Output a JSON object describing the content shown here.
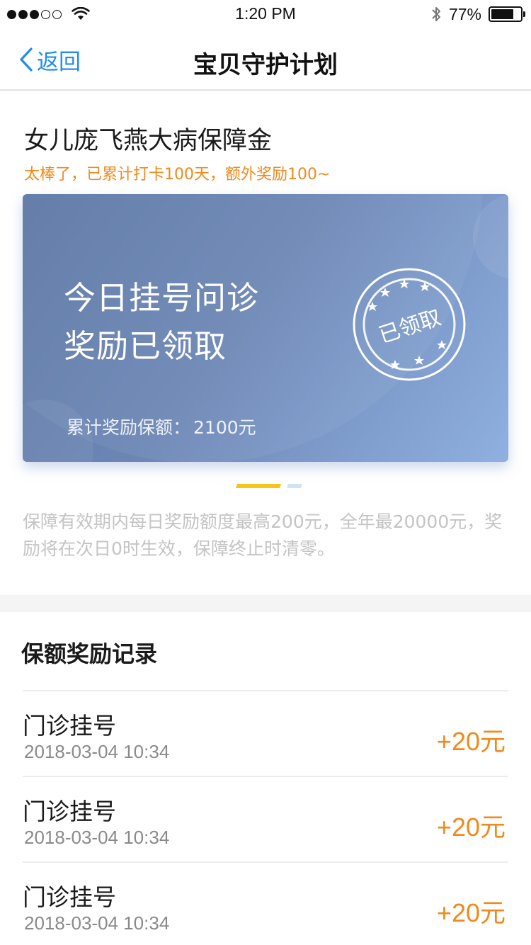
{
  "status_bar": {
    "time": "1:20 PM",
    "battery_percent": "77%",
    "battery_level": 0.77,
    "signal_dots_filled": 3,
    "signal_dots_total": 5
  },
  "nav": {
    "back_label": "返回",
    "title": "宝贝守护计划"
  },
  "plan": {
    "title": "女儿庞飞燕大病保障金",
    "subtitle": "太棒了，已累计打卡100天，额外奖励100~",
    "card": {
      "line1": "今日挂号问诊",
      "line2": "奖励已领取",
      "total_label": "累计奖励保额：",
      "total_value": "2100元",
      "stamp_text": "已领取"
    },
    "note": "保障有效期内每日奖励额度最高200元，全年最20000元，奖励将在次日0时生效，保障终止时清零。"
  },
  "records": {
    "title": "保额奖励记录",
    "items": [
      {
        "name": "门诊挂号",
        "time": "2018-03-04 10:34",
        "amount": "+20元"
      },
      {
        "name": "门诊挂号",
        "time": "2018-03-04 10:34",
        "amount": "+20元"
      },
      {
        "name": "门诊挂号",
        "time": "2018-03-04 10:34",
        "amount": "+20元"
      }
    ]
  },
  "colors": {
    "accent_blue": "#1f8cf0",
    "accent_orange": "#f08a1c",
    "card_start": "#5d78a5",
    "card_end": "#8fb0e0"
  }
}
